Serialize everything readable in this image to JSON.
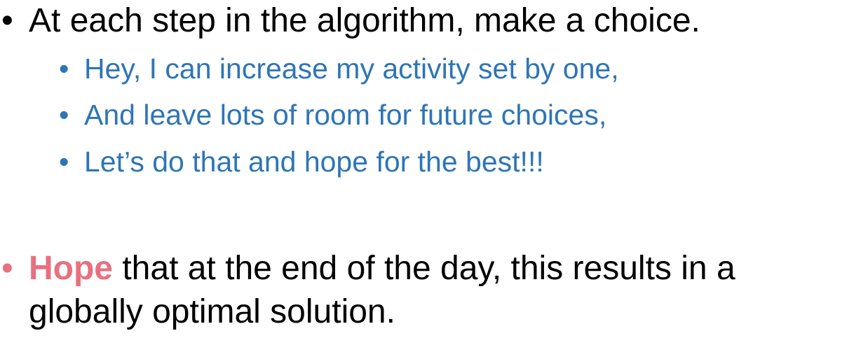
{
  "colors": {
    "text_primary": "#000000",
    "sub_bullet": "#2e75b6",
    "emphasis": "#e8707f"
  },
  "bullet_glyph": "•",
  "main": {
    "point_1": "At each step in the algorithm, make a choice.",
    "sub_points": [
      "Hey, I can increase my activity set by one,",
      "And leave lots of room for future choices,",
      "Let’s do that and hope for the best!!!"
    ],
    "point_2": {
      "emphasis": "Hope",
      "rest_line_1": " that at the end of the day, this results in a",
      "line_2": "globally optimal solution."
    }
  }
}
